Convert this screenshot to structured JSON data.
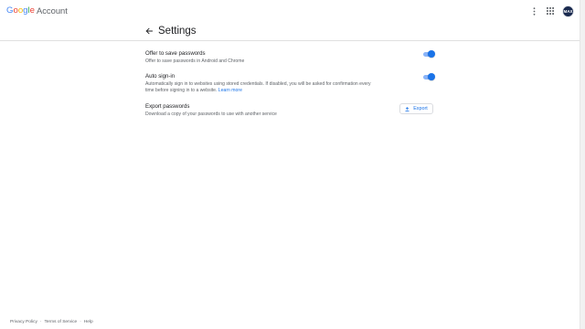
{
  "header": {
    "logo_letters": [
      "G",
      "o",
      "o",
      "g",
      "l",
      "e"
    ],
    "logo_colors": [
      "#4285f4",
      "#ea4335",
      "#fbbc05",
      "#4285f4",
      "#34a853",
      "#ea4335"
    ],
    "product": "Account",
    "menu_icon": "more-vert-icon",
    "apps_icon": "apps-grid-icon",
    "avatar_initials": "MAX"
  },
  "page": {
    "back_icon": "arrow-back-icon",
    "title": "Settings"
  },
  "settings": {
    "offer": {
      "title": "Offer to save passwords",
      "description": "Offer to save passwords in Android and Chrome",
      "enabled": true
    },
    "auto_signin": {
      "title": "Auto sign-in",
      "description": "Automatically sign in to websites using stored credentials. If disabled, you will be asked for confirmation every time before signing in to a website.",
      "link": "Learn more",
      "enabled": true
    },
    "export": {
      "title": "Export passwords",
      "description": "Download a copy of your passwords to use with another service",
      "button_label": "Export",
      "button_icon": "upload-icon"
    }
  },
  "footer": {
    "links": [
      "Privacy Policy",
      "Terms of Service",
      "Help"
    ]
  },
  "colors": {
    "accent": "#1a73e8",
    "toggle_track": "#8ab4f8"
  }
}
